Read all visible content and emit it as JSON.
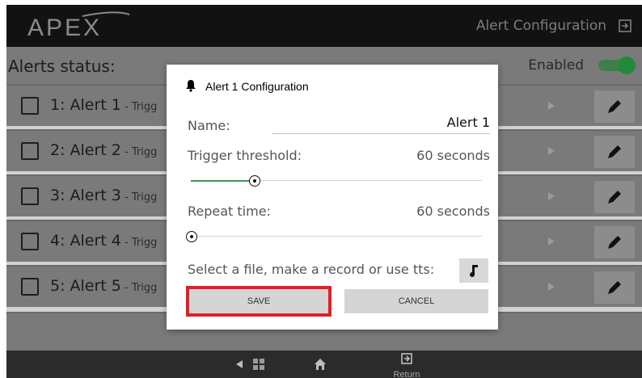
{
  "app": {
    "brand": "APEX",
    "title": "Alert Configuration"
  },
  "status": {
    "label": "Alerts status:",
    "enabled_label": "Enabled",
    "enabled": true
  },
  "alerts": [
    {
      "name": "1: Alert 1",
      "sub": " - Trigg"
    },
    {
      "name": "2: Alert 2",
      "sub": " - Trigg"
    },
    {
      "name": "3: Alert 3",
      "sub": " - Trigg"
    },
    {
      "name": "4: Alert 4",
      "sub": " - Trigg"
    },
    {
      "name": "5: Alert 5",
      "sub": " - Trigg"
    }
  ],
  "dialog": {
    "title": "Alert 1 Configuration",
    "name_label": "Name:",
    "name_value": "Alert 1",
    "trigger_label": "Trigger threshold:",
    "trigger_value": "60 seconds",
    "trigger_fraction": 0.22,
    "repeat_label": "Repeat time:",
    "repeat_value": "60 seconds",
    "repeat_fraction": 0.0,
    "file_label": "Select a file, make a record or use tts:",
    "save_label": "SAVE",
    "cancel_label": "CANCEL"
  },
  "nav": {
    "return_label": "Return"
  },
  "colors": {
    "accent_green": "#3c9a55",
    "highlight_red": "#e21f26"
  },
  "icons": {
    "exit": "exit-icon",
    "bell": "bell-icon",
    "play": "play-icon",
    "edit": "pencil-icon",
    "music": "music-note-icon",
    "back": "back-icon",
    "grid": "grid-icon",
    "home": "home-icon",
    "return": "return-icon"
  }
}
